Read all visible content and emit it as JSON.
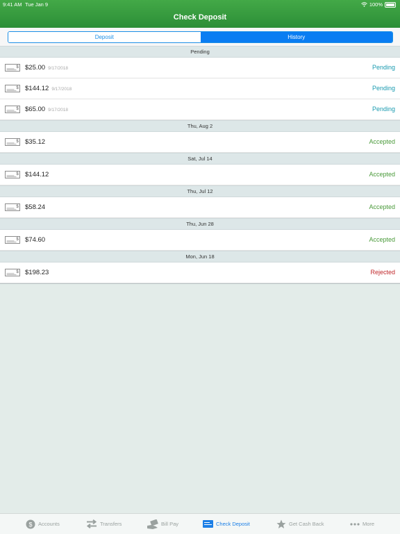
{
  "status_bar": {
    "time": "9:41 AM",
    "date": "Tue Jan 9",
    "battery": "100%"
  },
  "header": {
    "title": "Check Deposit"
  },
  "segments": {
    "deposit": "Deposit",
    "history": "History"
  },
  "sections": [
    {
      "header": "Pending",
      "items": [
        {
          "amount": "$25.00",
          "date": "9/17/2018",
          "status": "Pending"
        },
        {
          "amount": "$144.12",
          "date": "9/17/2018",
          "status": "Pending"
        },
        {
          "amount": "$65.00",
          "date": "9/17/2018",
          "status": "Pending"
        }
      ]
    },
    {
      "header": "Thu, Aug 2",
      "items": [
        {
          "amount": "$35.12",
          "status": "Accepted"
        }
      ]
    },
    {
      "header": "Sat, Jul 14",
      "items": [
        {
          "amount": "$144.12",
          "status": "Accepted"
        }
      ]
    },
    {
      "header": "Thu, Jul 12",
      "items": [
        {
          "amount": "$58.24",
          "status": "Accepted"
        }
      ]
    },
    {
      "header": "Thu, Jun 28",
      "items": [
        {
          "amount": "$74.60",
          "status": "Accepted"
        }
      ]
    },
    {
      "header": "Mon, Jun 18",
      "items": [
        {
          "amount": "$198.23",
          "status": "Rejected"
        }
      ]
    }
  ],
  "status_colors": {
    "Pending": "#1a9bb0",
    "Accepted": "#4a9a3a",
    "Rejected": "#c0282b"
  },
  "check_icon_symbol": "$",
  "tabs": {
    "accounts": {
      "label": "Accounts",
      "icon": "dollar-circle-icon"
    },
    "transfers": {
      "label": "Transfers",
      "icon": "swap-arrows-icon"
    },
    "bill_pay": {
      "label": "Bill Pay",
      "icon": "bill-hand-icon"
    },
    "check_deposit": {
      "label": "Check Deposit",
      "icon": "check-card-icon"
    },
    "cash_back": {
      "label": "Get Cash Back",
      "icon": "star-icon"
    },
    "more": {
      "label": "More",
      "icon": "ellipsis-icon"
    }
  }
}
